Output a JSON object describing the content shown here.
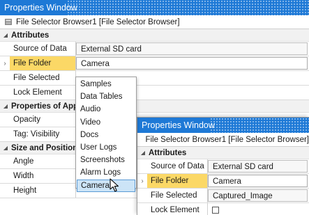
{
  "window_main": {
    "title": "Properties Window",
    "object_title": "File Selector Browser1 [File Selector Browser]",
    "sections": {
      "attributes": "Attributes",
      "properties_of_app": "Properties of App",
      "size_and_position": "Size and Position"
    },
    "rows": {
      "source_of_data": {
        "name": "Source of Data",
        "value": "External SD card"
      },
      "file_folder": {
        "name": "File Folder",
        "value": "Camera"
      },
      "file_selected": {
        "name": "File Selected"
      },
      "lock_element": {
        "name": "Lock Element"
      },
      "opacity": {
        "name": "Opacity"
      },
      "tag_visibility": {
        "name": "Tag: Visibility"
      },
      "angle": {
        "name": "Angle"
      },
      "width": {
        "name": "Width"
      },
      "height": {
        "name": "Height"
      }
    }
  },
  "dropdown": {
    "options": [
      "Samples",
      "Data Tables",
      "Audio",
      "Video",
      "Docs",
      "User Logs",
      "Screenshots",
      "Alarm Logs",
      "Camera"
    ],
    "hovered": "Camera"
  },
  "window_popup": {
    "title": "Properties Window",
    "object_title": "File Selector Browser1 [File Selector Browser]",
    "sections": {
      "attributes": "Attributes"
    },
    "rows": {
      "source_of_data": {
        "name": "Source of Data",
        "value": "External SD card"
      },
      "file_folder": {
        "name": "File Folder",
        "value": "Camera"
      },
      "file_selected": {
        "name": "File Selected",
        "value": "Captured_Image"
      },
      "lock_element": {
        "name": "Lock Element"
      }
    }
  },
  "colors": {
    "titlebar": "#1e79d6",
    "selected_row": "#fbd866",
    "hover_item": "#cce4f7"
  },
  "icons": [
    "object-icon",
    "collapse-triangle-icon",
    "row-pointer-icon",
    "checkbox-icon",
    "mouse-cursor-icon"
  ]
}
